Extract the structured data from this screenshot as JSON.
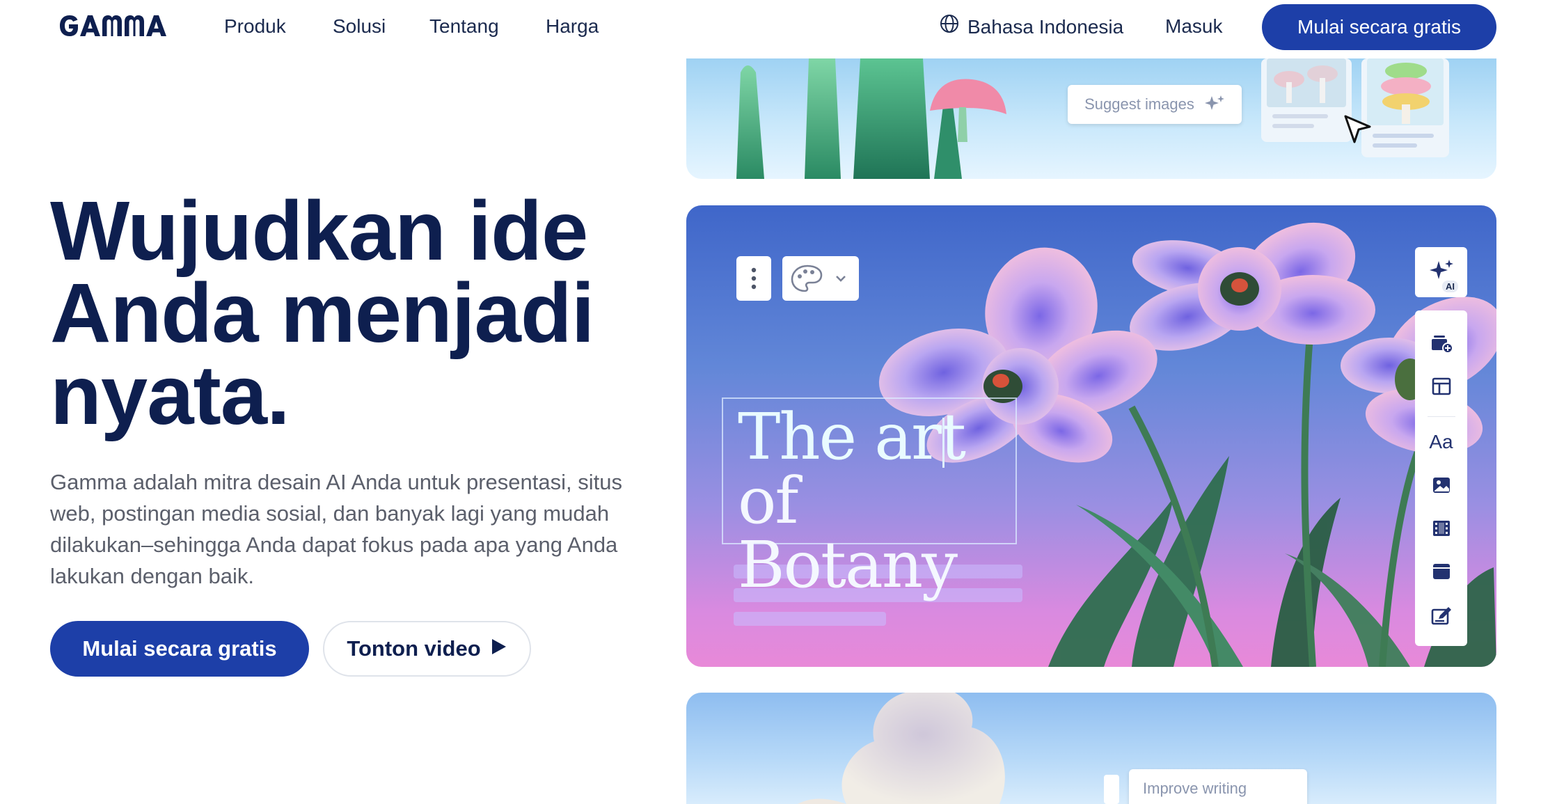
{
  "brand": {
    "logo_text": "GAMMA",
    "primary_color": "#1d3fa8",
    "text_color": "#0e1f4f"
  },
  "nav": {
    "links": [
      "Produk",
      "Solusi",
      "Tentang",
      "Harga"
    ],
    "language": "Bahasa Indonesia",
    "login": "Masuk",
    "cta": "Mulai secara gratis"
  },
  "hero": {
    "title_lines": [
      "Wujudkan ide",
      "Anda menjadi",
      "nyata."
    ],
    "subtitle": "Gamma adalah mitra desain AI Anda untuk presentasi, situs web, postingan media sosial, dan banyak lagi yang mudah dilakukan–sehingga Anda dapat fokus pada apa yang Anda lakukan dengan baik.",
    "primary_cta": "Mulai secara gratis",
    "secondary_cta": "Tonton video"
  },
  "preview": {
    "top_card": {
      "suggest_label": "Suggest images"
    },
    "main_card": {
      "heading_lines": [
        "The art",
        "of Botany"
      ],
      "ai_badge": "AI",
      "toolbar_icons": [
        "card-menu-icon",
        "theme-palette-icon",
        "chevron-down-icon"
      ],
      "side_tools": [
        "add-card-icon",
        "layout-icon",
        "text-style-icon",
        "image-icon",
        "video-icon",
        "embed-icon",
        "edit-form-icon"
      ],
      "text_style_glyph": "Aa"
    },
    "bottom_card": {
      "suggest_label": "Improve writing"
    }
  }
}
